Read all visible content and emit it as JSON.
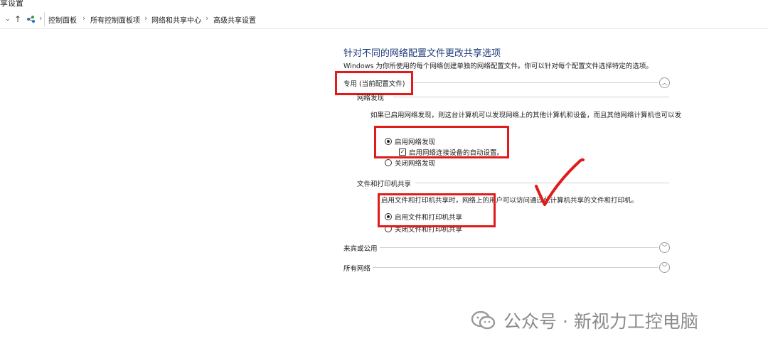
{
  "window": {
    "title": "享设置"
  },
  "address_bar": {
    "crumbs": [
      "控制面板",
      "所有控制面板项",
      "网络和共享中心",
      "高级共享设置"
    ]
  },
  "main": {
    "heading": "针对不同的网络配置文件更改共享选项",
    "description": "Windows 为你所使用的每个网络创建单独的网络配置文件。你可以针对每个配置文件选择特定的选项。",
    "private": {
      "title": "专用 (当前配置文件)",
      "network_discovery": {
        "title": "网络发现",
        "text": "如果已启用网络发现，则这台计算机可以发现网络上的其他计算机和设备，而且其他网络计算机也可以发现这台计算机。",
        "on_label": "启用网络发现",
        "auto_setup_label": "启用网络连接设备的自动设置。",
        "off_label": "关闭网络发现"
      },
      "file_printer": {
        "title": "文件和打印机共享",
        "text": "启用文件和打印机共享时，网络上的用户可以访问通过此计算机共享的文件和打印机。",
        "on_label": "启用文件和打印机共享",
        "off_label": "关闭文件和打印机共享"
      }
    },
    "guest_public": {
      "title": "来宾或公用"
    },
    "all_networks": {
      "title": "所有网络"
    }
  },
  "watermark": {
    "text": "公众号 · 新视力工控电脑"
  },
  "colors": {
    "heading": "#1e3b7a",
    "annotation_red": "#e11a1a"
  }
}
